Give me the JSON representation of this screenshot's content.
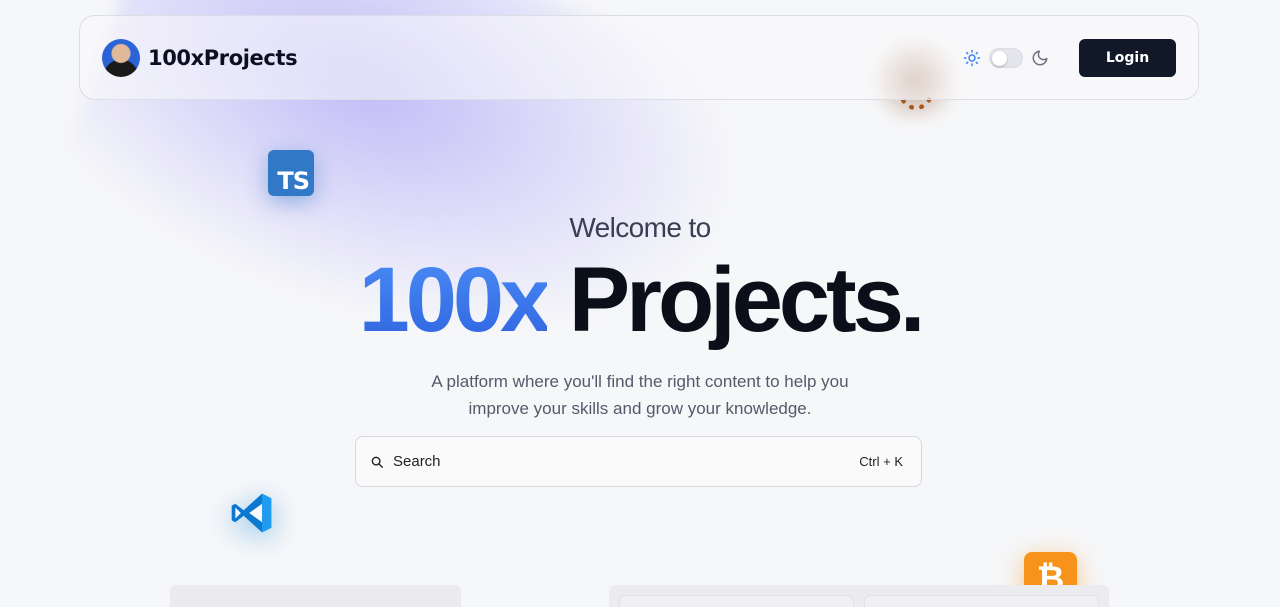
{
  "navbar": {
    "brand_name": "100xProjects",
    "login_label": "Login",
    "theme_toggle": {
      "mode": "light"
    }
  },
  "hero": {
    "welcome": "Welcome to",
    "title_accent": "100x",
    "title_main": "Projects.",
    "subtitle_line1": "A platform where you'll find the right content to help you",
    "subtitle_line2": "improve your skills and grow your knowledge."
  },
  "search": {
    "placeholder": "Search",
    "shortcut": "Ctrl + K"
  },
  "floating_icons": {
    "typescript": "TS",
    "bitcoin": "₿"
  },
  "colors": {
    "accent": "#3a73ea",
    "login_bg": "#111827",
    "typescript": "#3178c6",
    "bitcoin": "#f7931a",
    "vscode": "#0078d4"
  }
}
